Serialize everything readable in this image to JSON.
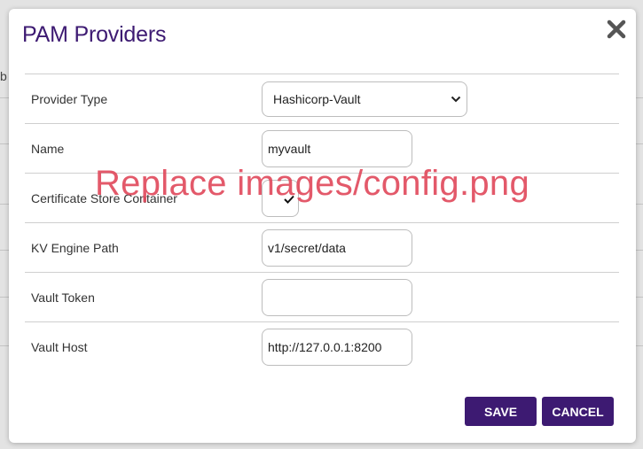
{
  "modal": {
    "title": "PAM Providers"
  },
  "form": {
    "provider_type": {
      "label": "Provider Type",
      "value": "Hashicorp-Vault"
    },
    "name": {
      "label": "Name",
      "value": "myvault"
    },
    "cert_store": {
      "label": "Certificate Store Container",
      "checked": true
    },
    "kv_engine_path": {
      "label": "KV Engine Path",
      "value": "v1/secret/data"
    },
    "vault_token": {
      "label": "Vault Token",
      "value": ""
    },
    "vault_host": {
      "label": "Vault Host",
      "value": "http://127.0.0.1:8200"
    }
  },
  "overlay_text": "Replace images/config.png",
  "buttons": {
    "save": "SAVE",
    "cancel": "CANCEL"
  },
  "background": {
    "fragment": "b"
  },
  "colors": {
    "brand": "#3d1a72",
    "overlay": "#e0485a"
  }
}
